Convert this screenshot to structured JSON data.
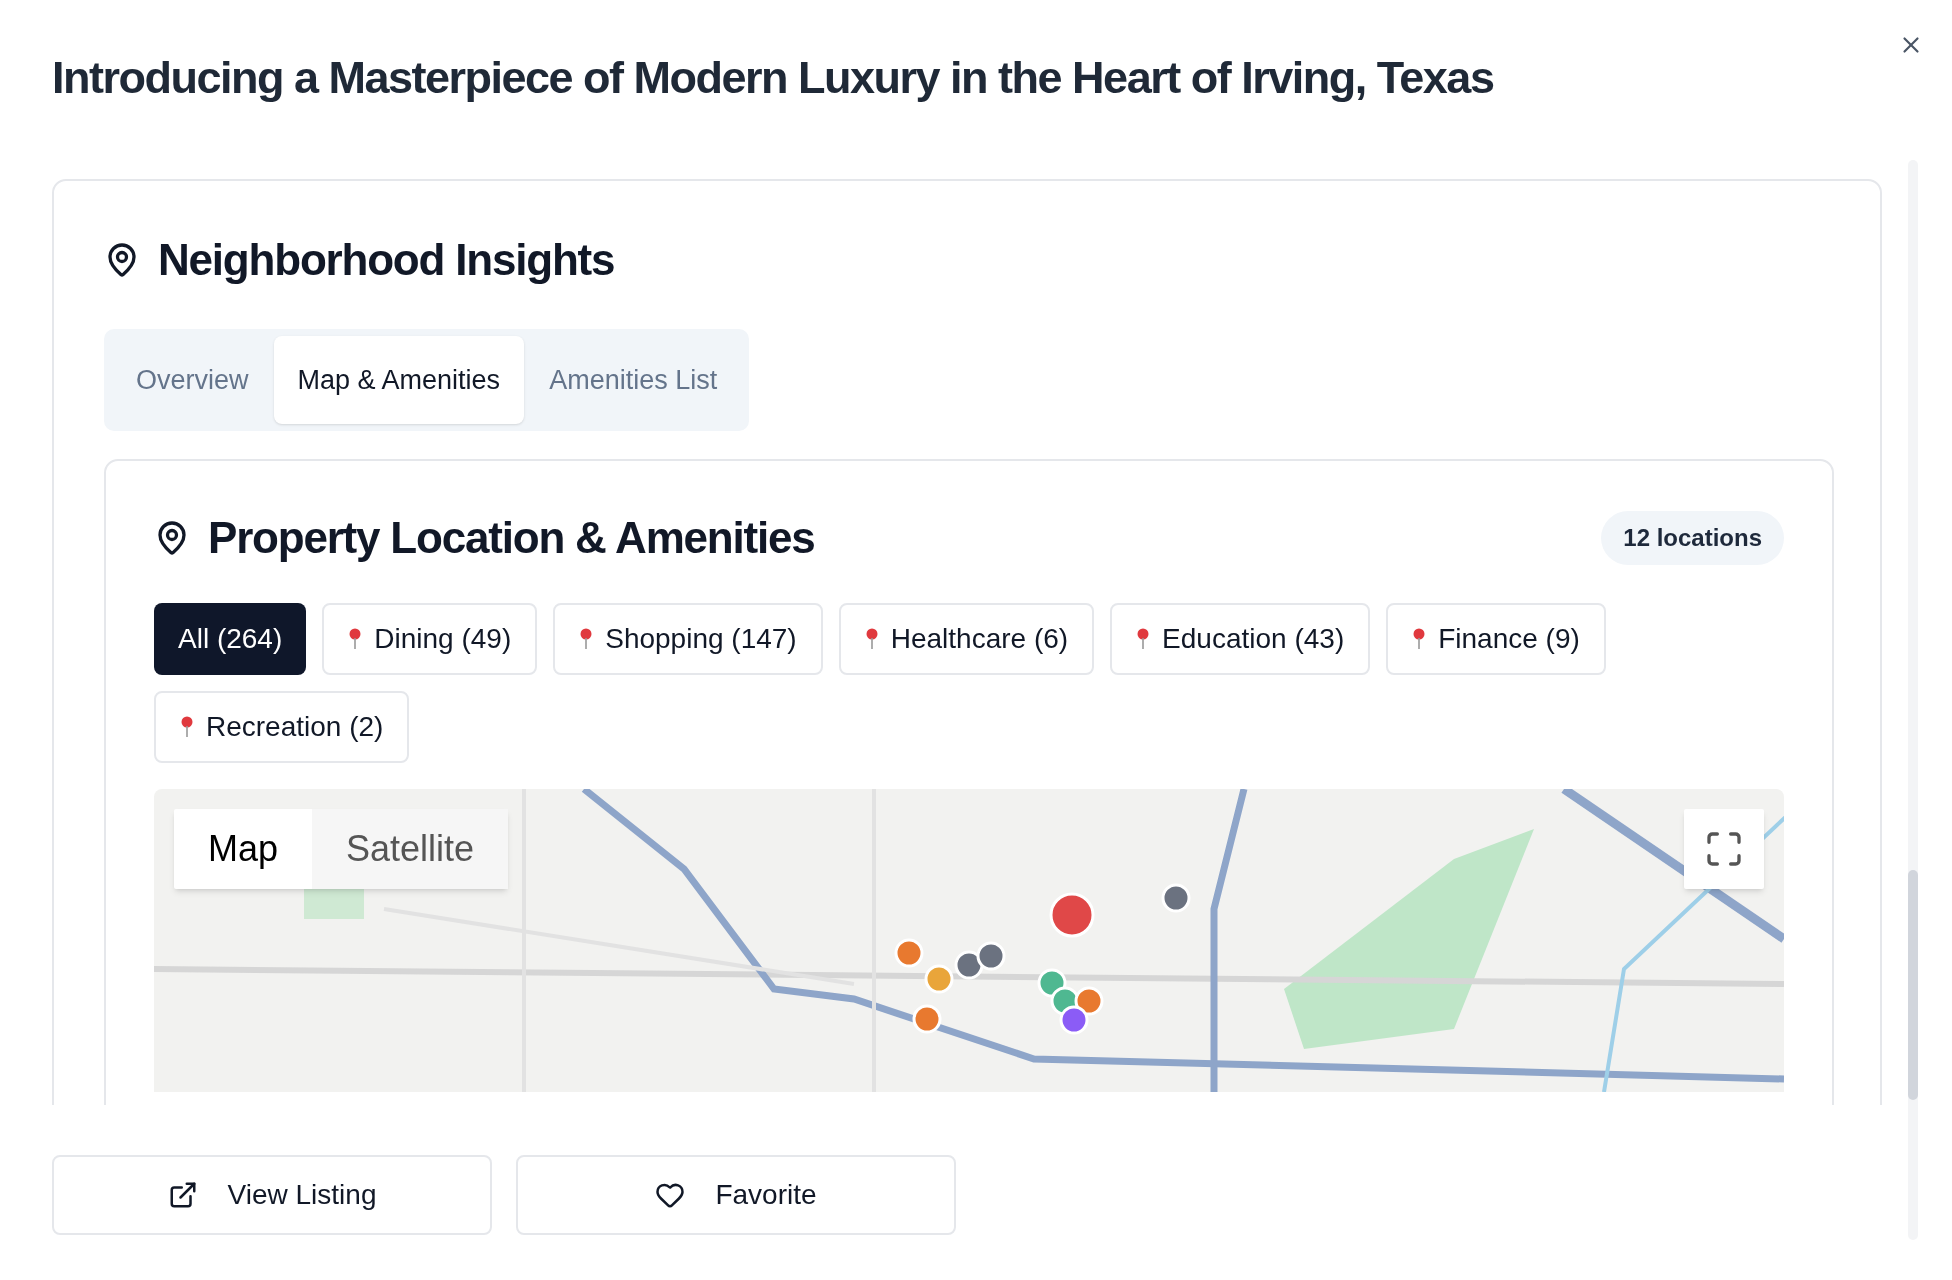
{
  "dialog": {
    "title": "Introducing a Masterpiece of Modern Luxury in the Heart of Irving, Texas"
  },
  "section": {
    "heading": "Neighborhood Insights",
    "tabs": [
      {
        "label": "Overview",
        "selected": false
      },
      {
        "label": "Map & Amenities",
        "selected": true
      },
      {
        "label": "Amenities List",
        "selected": false
      }
    ]
  },
  "panel": {
    "heading": "Property Location & Amenities",
    "badge": "12 locations",
    "filters": [
      {
        "label": "All (264)",
        "selected": true
      },
      {
        "label": "Dining (49)",
        "selected": false
      },
      {
        "label": "Shopping (147)",
        "selected": false
      },
      {
        "label": "Healthcare (6)",
        "selected": false
      },
      {
        "label": "Education (43)",
        "selected": false
      },
      {
        "label": "Finance (9)",
        "selected": false
      },
      {
        "label": "Recreation (2)",
        "selected": false
      }
    ],
    "map": {
      "kind": "picture",
      "view_toggle": [
        {
          "label": "Map",
          "selected": true
        },
        {
          "label": "Satellite",
          "selected": false
        }
      ]
    }
  },
  "actions": [
    {
      "label": "View Listing",
      "kind": "external"
    },
    {
      "label": "Favorite",
      "kind": "favorite"
    }
  ]
}
